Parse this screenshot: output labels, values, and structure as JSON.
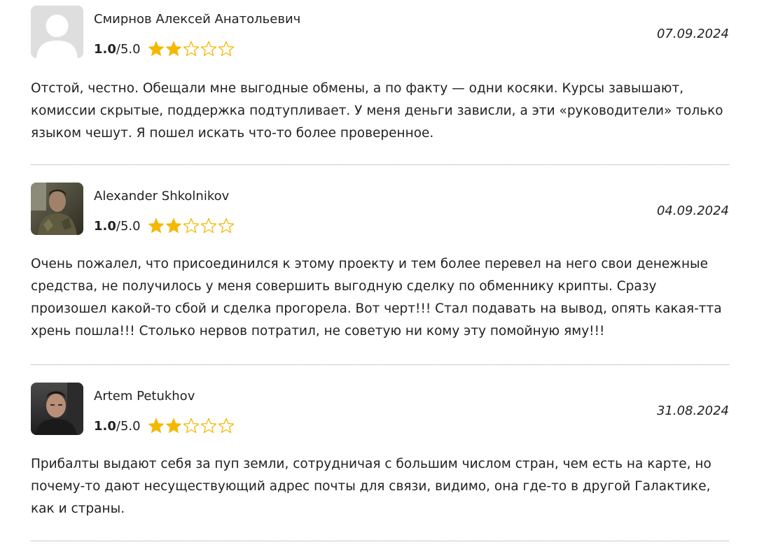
{
  "reviews": [
    {
      "author": "Смирнов Алексей Анатольевич",
      "avatar_icon": "default-user-icon",
      "rating_score": "1.0",
      "rating_max": "/5.0",
      "rating_value": 2,
      "stars_total": 5,
      "date": "07.09.2024",
      "text": "Отстой, честно. Обещали мне выгодные обмены, а по факту — одни косяки. Курсы завышают, комиссии скрытые, поддержка подтупливает. У меня деньги зависли, а эти «руководители» только языком чешут. Я пошел искать что-то более проверенное."
    },
    {
      "author": "Alexander Shkolnikov",
      "avatar_icon": "user-photo",
      "rating_score": "1.0",
      "rating_max": "/5.0",
      "rating_value": 2,
      "stars_total": 5,
      "date": "04.09.2024",
      "text": "Очень пожалел, что присоединился к этому проекту и тем более перевел на него свои денежные средства, не получилось у меня совершить выгодную сделку по обменнику крипты. Сразу произошел какой-то сбой и сделка прогорела. Вот черт!!! Стал подавать на вывод, опять какая-тта хрень пошла!!! Столько нервов потратил, не советую ни кому эту помойную яму!!!"
    },
    {
      "author": "Artem Petukhov",
      "avatar_icon": "user-photo",
      "rating_score": "1.0",
      "rating_max": "/5.0",
      "rating_value": 2,
      "stars_total": 5,
      "date": "31.08.2024",
      "text": "Прибалты выдают себя за пуп земли, сотрудничая с большим числом стран, чем есть на карте, но почему-то дают несуществующий адрес почты для связи, видимо, она где-то в другой Галактике, как и страны."
    }
  ],
  "colors": {
    "star_filled": "#F5B800",
    "star_empty_outline": "#F5B800",
    "separator": "#9a9a9a",
    "text": "#222222"
  }
}
